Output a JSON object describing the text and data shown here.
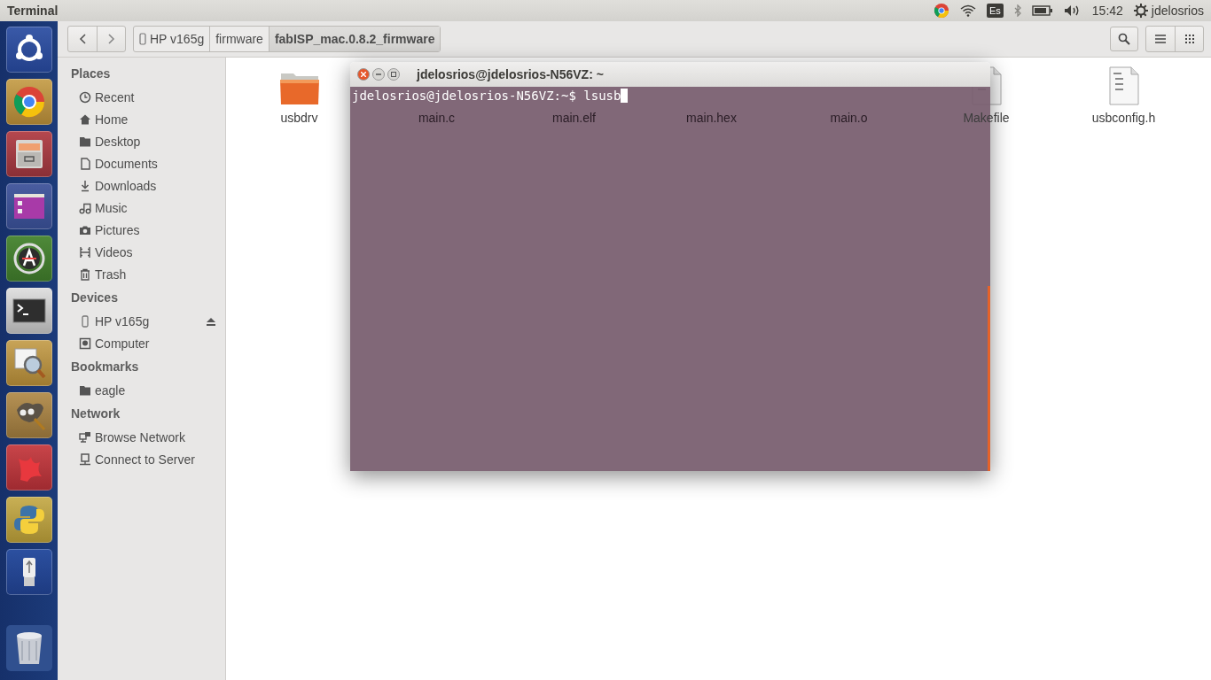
{
  "top_bar": {
    "app_title": "Terminal",
    "keyboard": "Es",
    "clock": "15:42",
    "user": "jdelosrios"
  },
  "toolbar": {
    "breadcrumbs": [
      {
        "label": "HP v165g",
        "kind": "device",
        "selected": false
      },
      {
        "label": "firmware",
        "kind": "folder",
        "selected": false
      },
      {
        "label": "fabISP_mac.0.8.2_firmware",
        "kind": "folder",
        "selected": true
      }
    ]
  },
  "sidebar": {
    "sections": [
      {
        "title": "Places",
        "items": [
          {
            "label": "Recent",
            "kind": "recent"
          },
          {
            "label": "Home",
            "kind": "home"
          },
          {
            "label": "Desktop",
            "kind": "folder"
          },
          {
            "label": "Documents",
            "kind": "document"
          },
          {
            "label": "Downloads",
            "kind": "download"
          },
          {
            "label": "Music",
            "kind": "music"
          },
          {
            "label": "Pictures",
            "kind": "picture"
          },
          {
            "label": "Videos",
            "kind": "video"
          },
          {
            "label": "Trash",
            "kind": "trash"
          }
        ]
      },
      {
        "title": "Devices",
        "items": [
          {
            "label": "HP v165g",
            "kind": "drive",
            "ejectable": true
          },
          {
            "label": "Computer",
            "kind": "computer"
          }
        ]
      },
      {
        "title": "Bookmarks",
        "items": [
          {
            "label": "eagle",
            "kind": "folder"
          }
        ]
      },
      {
        "title": "Network",
        "items": [
          {
            "label": "Browse Network",
            "kind": "network"
          },
          {
            "label": "Connect to Server",
            "kind": "server"
          }
        ]
      }
    ]
  },
  "files": [
    {
      "name": "usbdrv",
      "kind": "folder"
    },
    {
      "name": "main.c",
      "kind": "covered"
    },
    {
      "name": "main.elf",
      "kind": "covered"
    },
    {
      "name": "main.hex",
      "kind": "covered"
    },
    {
      "name": "main.o",
      "kind": "covered"
    },
    {
      "name": "Makefile",
      "kind": "text"
    },
    {
      "name": "usbconfig.h",
      "kind": "text"
    }
  ],
  "terminal": {
    "title": "jdelosrios@jdelosrios-N56VZ: ~",
    "prompt": "jdelosrios@jdelosrios-N56VZ:~$ ",
    "command": "lsusb"
  }
}
